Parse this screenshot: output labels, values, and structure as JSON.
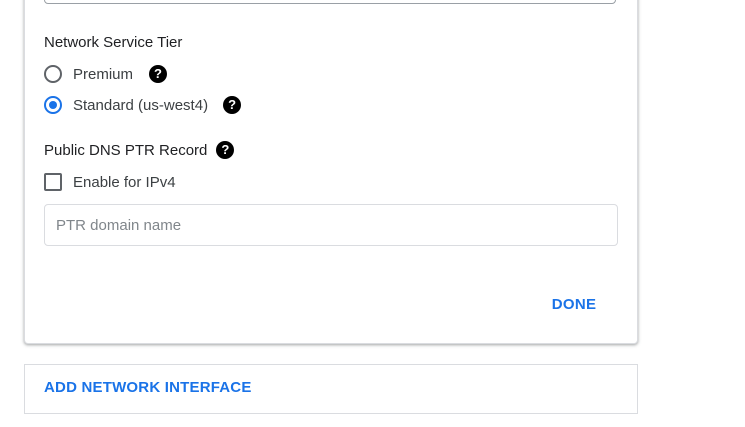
{
  "network_service_tier": {
    "title": "Network Service Tier",
    "options": [
      {
        "label": "Premium",
        "checked": false
      },
      {
        "label": "Standard (us-west4)",
        "checked": true
      }
    ]
  },
  "ptr_record": {
    "title": "Public DNS PTR Record",
    "checkbox_label": "Enable for IPv4",
    "checkbox_checked": false,
    "input_value": "",
    "input_placeholder": "PTR domain name"
  },
  "help_glyph": "?",
  "actions": {
    "done_label": "DONE",
    "add_interface_label": "ADD NETWORK INTERFACE"
  },
  "colors": {
    "accent": "#1a73e8",
    "text": "#202124",
    "border": "#dadce0"
  }
}
